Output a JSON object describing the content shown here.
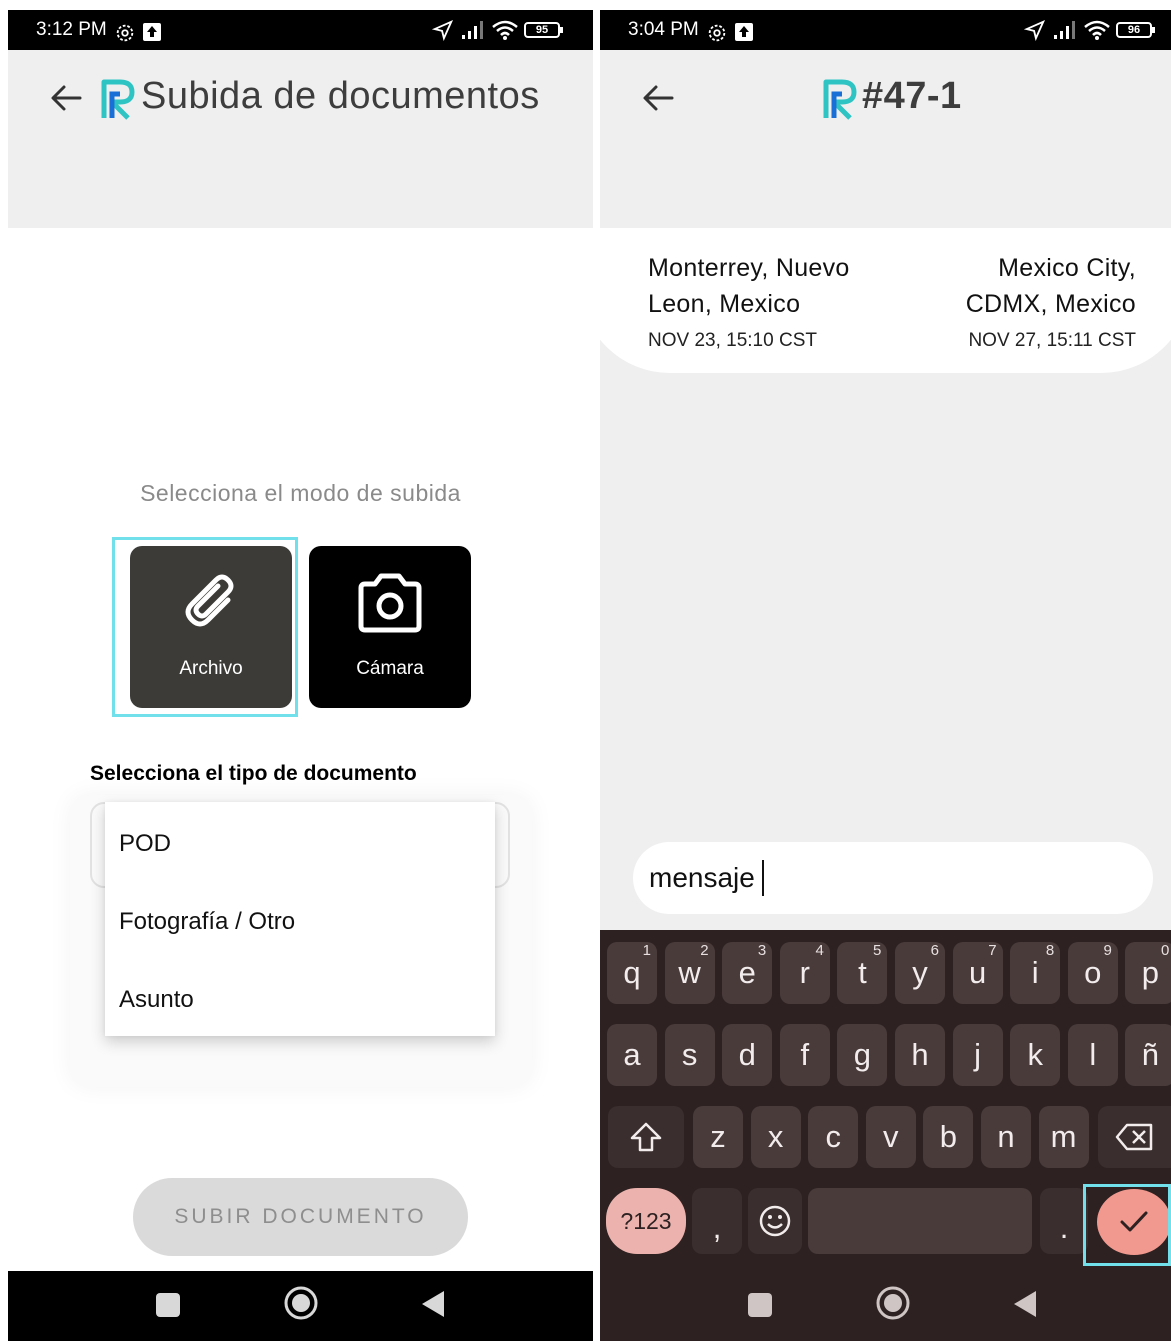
{
  "left_screen": {
    "status_time": "3:12 PM",
    "battery": "95",
    "title": "Subida de documentos",
    "upload_mode_prompt": "Selecciona el modo de subida",
    "mode_file_label": "Archivo",
    "mode_camera_label": "Cámara",
    "doc_type_label": "Selecciona el tipo de documento",
    "doc_type_options": [
      "POD",
      "Fotografía / Otro",
      "Asunto"
    ],
    "upload_button": "SUBIR DOCUMENTO"
  },
  "right_screen": {
    "status_time": "3:04 PM",
    "battery": "96",
    "title": "#47-1",
    "origin_line1": "Monterrey, Nuevo",
    "origin_line2": "Leon, Mexico",
    "origin_date": "NOV 23, 15:10 CST",
    "destination_line1": "Mexico City,",
    "destination_line2": "CDMX, Mexico",
    "destination_date": "NOV 27, 15:11 CST",
    "message_value": "mensaje",
    "keyboard": {
      "row1": [
        {
          "k": "q",
          "n": "1"
        },
        {
          "k": "w",
          "n": "2"
        },
        {
          "k": "e",
          "n": "3"
        },
        {
          "k": "r",
          "n": "4"
        },
        {
          "k": "t",
          "n": "5"
        },
        {
          "k": "y",
          "n": "6"
        },
        {
          "k": "u",
          "n": "7"
        },
        {
          "k": "i",
          "n": "8"
        },
        {
          "k": "o",
          "n": "9"
        },
        {
          "k": "p",
          "n": "0"
        }
      ],
      "row2": [
        "a",
        "s",
        "d",
        "f",
        "g",
        "h",
        "j",
        "k",
        "l",
        "ñ"
      ],
      "row3": [
        "z",
        "x",
        "c",
        "v",
        "b",
        "n",
        "m"
      ],
      "symbols_key": "?123",
      "comma_key": ",",
      "period_key": "."
    }
  },
  "colors": {
    "brand_teal": "#2ec4c4",
    "brand_blue": "#1a6fd6",
    "highlight": "#72e0ea",
    "file_button": "#3c3b37",
    "camera_button": "#000000",
    "keyboard_bg": "#2d2121",
    "enter_key": "#f2998f"
  }
}
